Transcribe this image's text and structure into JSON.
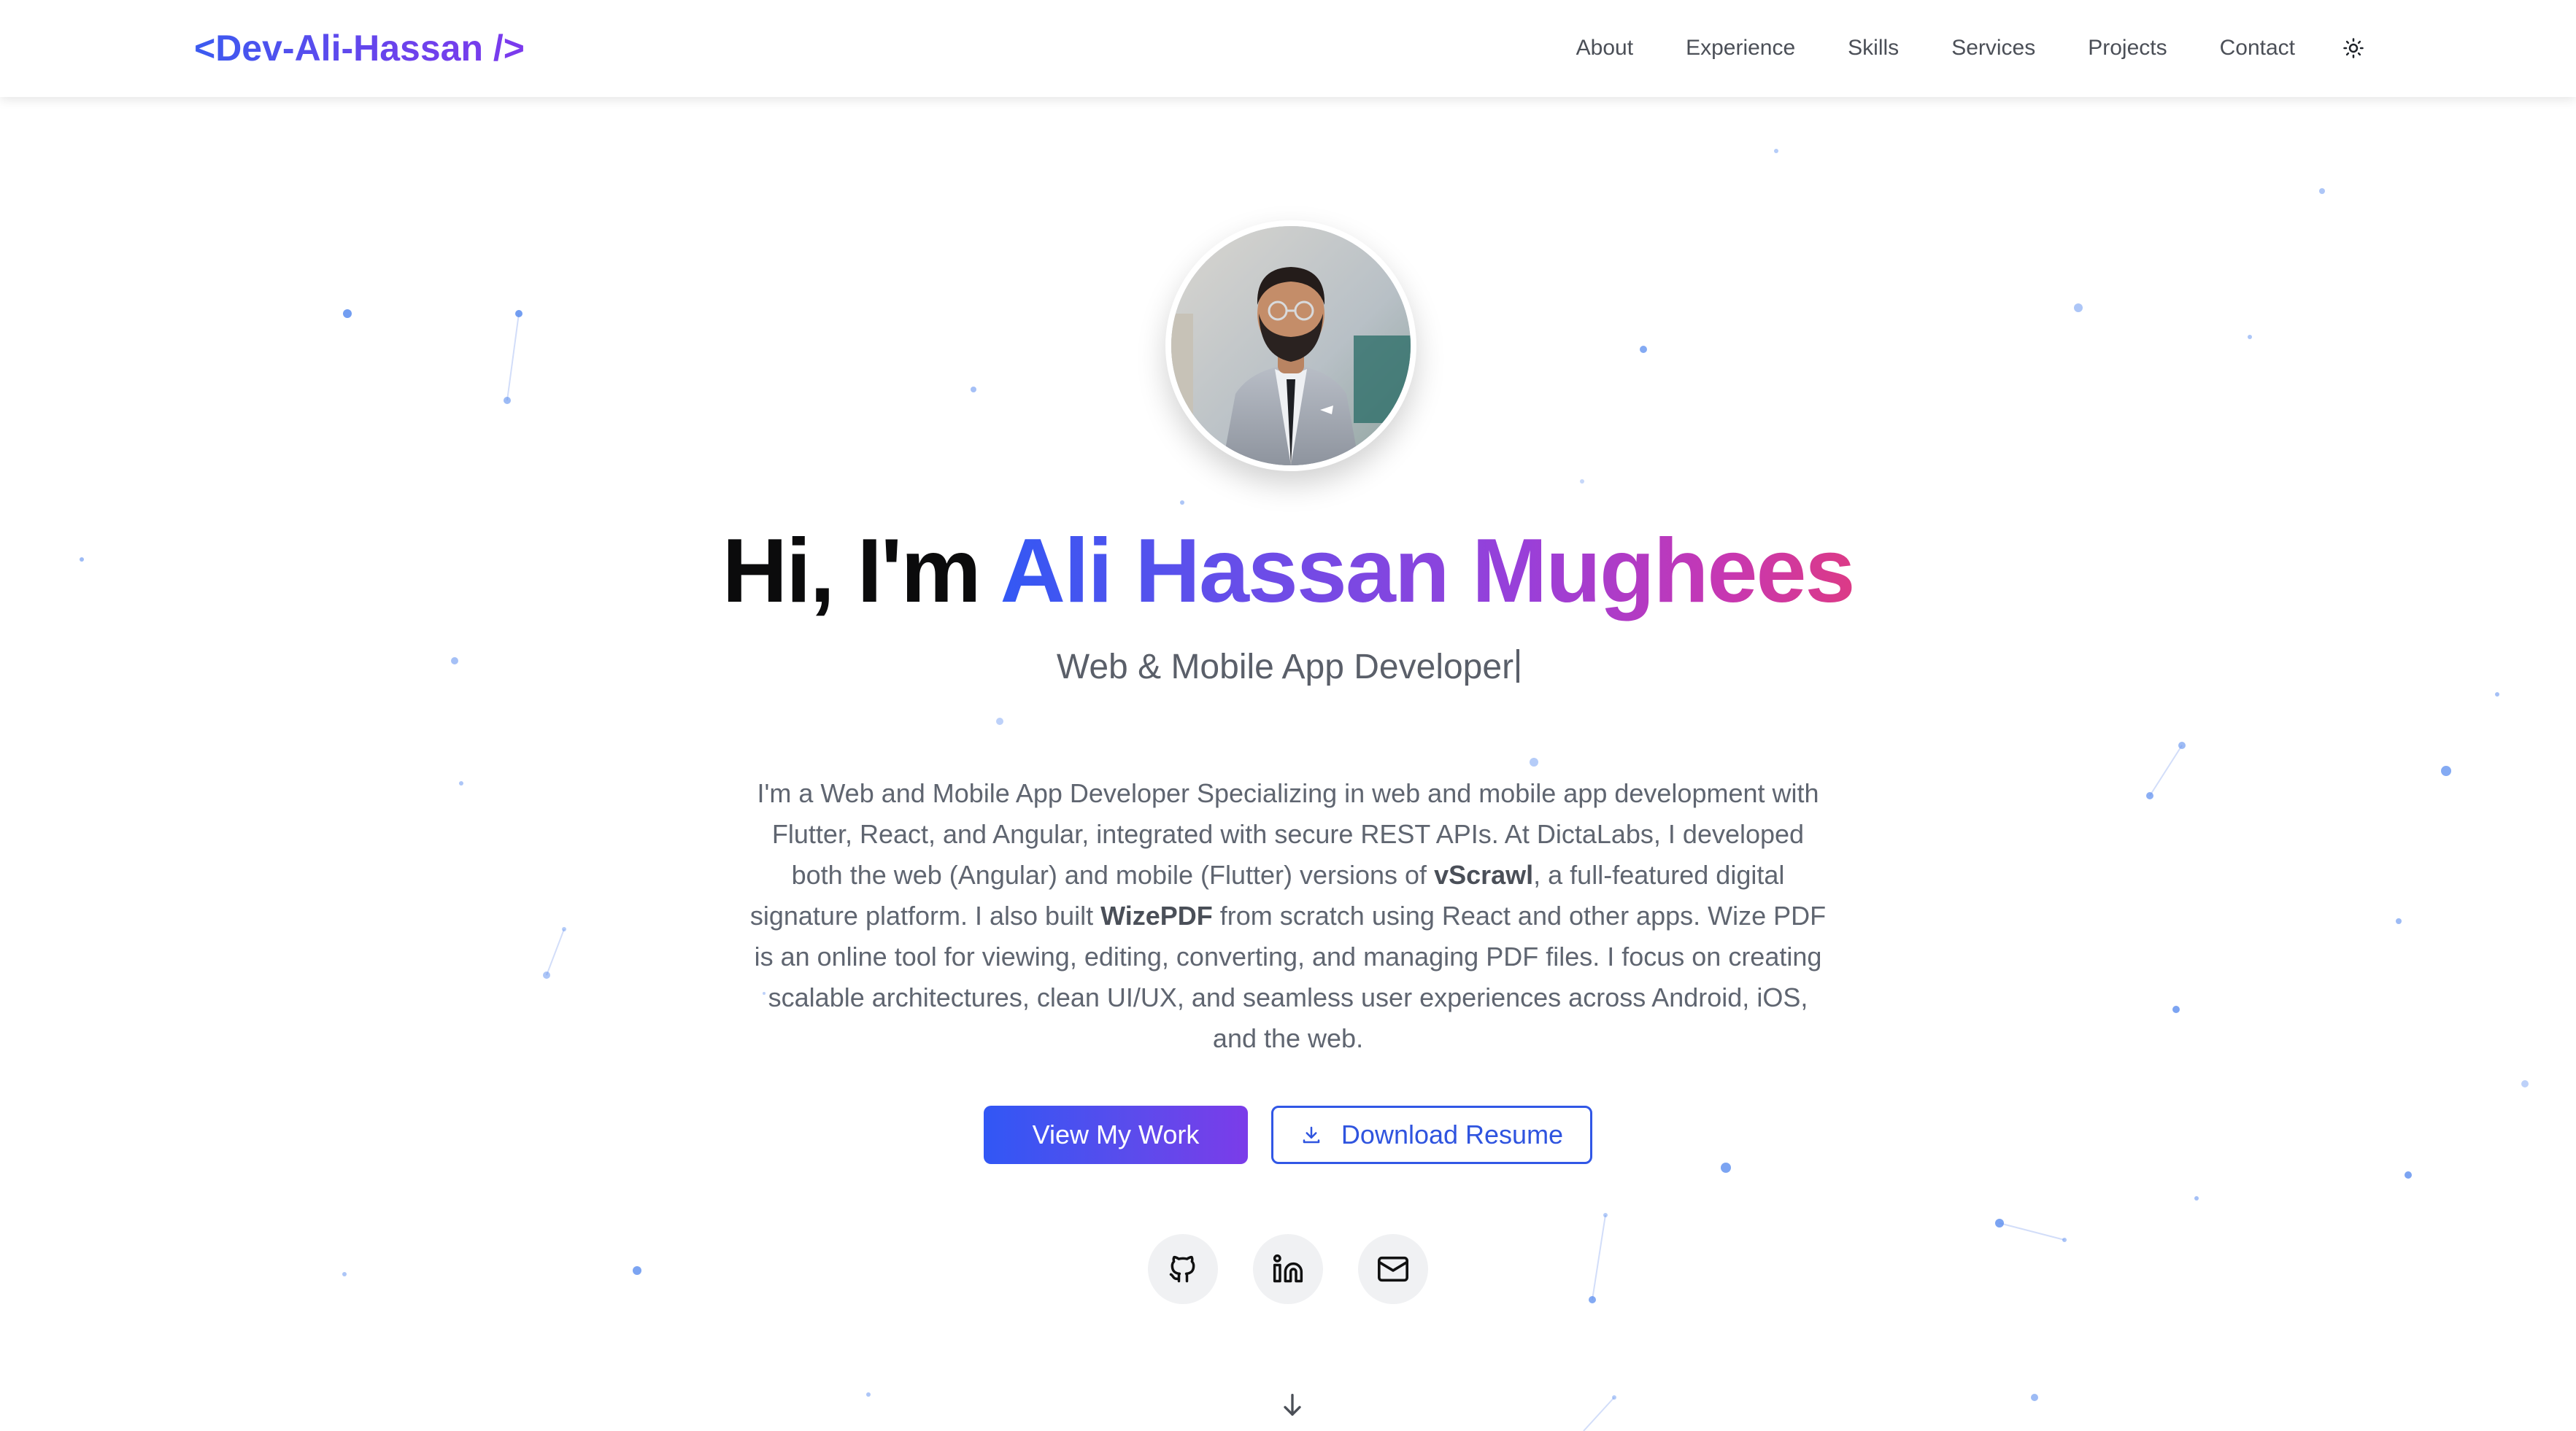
{
  "header": {
    "logo": "<Dev-Ali-Hassan />",
    "nav": [
      "About",
      "Experience",
      "Skills",
      "Services",
      "Projects",
      "Contact"
    ],
    "theme_icon": "sun-icon"
  },
  "hero": {
    "greeting": "Hi, I'm ",
    "name": "Ali Hassan Mughees",
    "subtitle": "Web & Mobile App Developer",
    "description": {
      "part1": "I'm a Web and Mobile App Developer Specializing in web and mobile app development with Flutter, React, and Angular, integrated with secure REST APIs. At DictaLabs, I developed both the web (Angular) and mobile (Flutter) versions of ",
      "bold1": "vScrawl",
      "part2": ", a full-featured digital signature platform. I also built ",
      "bold2": "WizePDF",
      "part3": " from scratch using React and other apps. Wize PDF is an online tool for viewing, editing, converting, and managing PDF files. I focus on creating scalable architectures, clean UI/UX, and seamless user experiences across Android, iOS, and the web."
    },
    "buttons": {
      "view_work": "View My Work",
      "download_resume": "Download Resume"
    },
    "social_icons": [
      "github-icon",
      "linkedin-icon",
      "mail-icon"
    ],
    "scroll_icon": "arrow-down-icon"
  },
  "colors": {
    "accent_start": "#3157f5",
    "accent_end": "#7b3ce9",
    "name_gradient_end": "#dc3a86",
    "particle": "#5b8def"
  }
}
